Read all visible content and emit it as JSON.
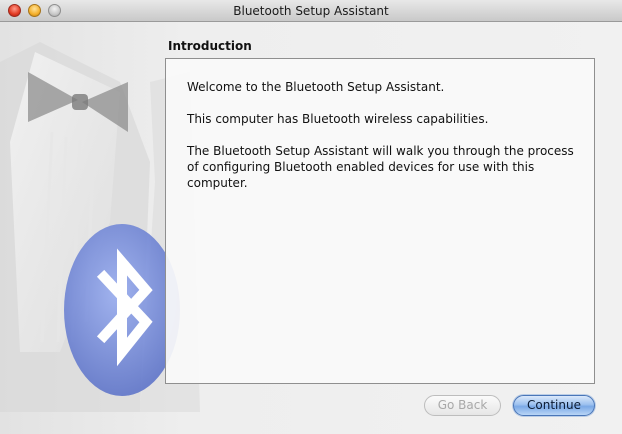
{
  "window": {
    "title": "Bluetooth Setup Assistant"
  },
  "section": {
    "title": "Introduction"
  },
  "body": {
    "paragraphs": [
      "Welcome to the Bluetooth Setup Assistant.",
      "This computer has Bluetooth wireless capabilities.",
      "The Bluetooth Setup Assistant will walk you through the process of configuring Bluetooth enabled devices for use with this computer."
    ]
  },
  "buttons": {
    "back_label": "Go Back",
    "back_enabled": false,
    "continue_label": "Continue"
  },
  "colors": {
    "accent": "#7ba9e6",
    "bluetooth_badge": "#6f86d6"
  },
  "icons": {
    "close": "close-light-icon",
    "minimize": "minimize-light-icon",
    "zoom": "zoom-light-icon",
    "bluetooth": "bluetooth-icon"
  }
}
